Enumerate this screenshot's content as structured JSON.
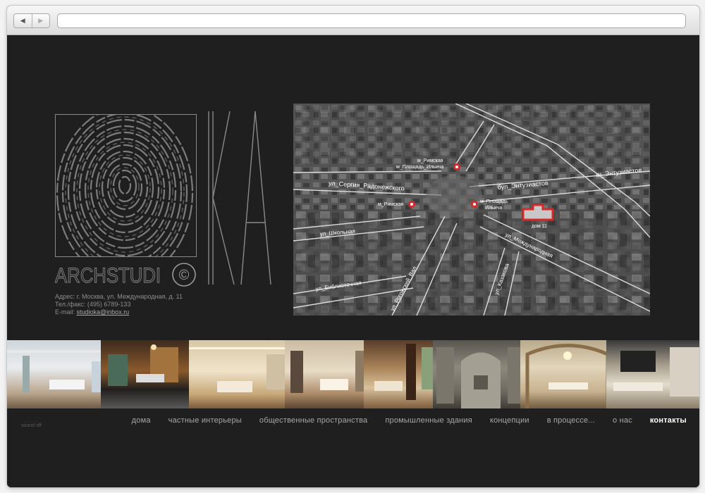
{
  "browser": {
    "back_glyph": "◀",
    "forward_glyph": "▶",
    "url": ""
  },
  "logo": {
    "word": "ARCHSTUDI",
    "copyright_glyph": "©",
    "initials": "KA",
    "icon": "fingerprint-icon"
  },
  "contact": {
    "address": "Адрес: г. Москва, ул. Международная, д. 11",
    "phone": "Тел./факс: (495) 6789-133",
    "email_label": "E-mail: ",
    "email": "studioka@inbox.ru"
  },
  "map": {
    "streets": {
      "radonezh": "ул_Сергия_Радонежского",
      "entuziastov_bul": "бул_Энтузиастов",
      "entuziastov_sh": "ш_Энтузиастов",
      "shkolnaya": "ул_Школьная",
      "mezhdunarodnaya": "ул_Международная",
      "bibliotechnaya": "ул_Библиотечная",
      "rogozhsky": "ул_Рогожский_Вал",
      "kazakova": "ул_Казакова"
    },
    "metro": {
      "top_line1": "м_Римская",
      "top_line2": "м_Площадь_Ильича",
      "left": "м_Римская",
      "right_line1": "м_Площадь",
      "right_line2": "Ильича"
    },
    "building": "дом 11",
    "marker_color": "#d42a2a"
  },
  "photos": [
    {
      "name": "white-living-room"
    },
    {
      "name": "dark-marble-interior"
    },
    {
      "name": "beige-lounge"
    },
    {
      "name": "long-gallery-room"
    },
    {
      "name": "screen-lounge"
    },
    {
      "name": "stone-fireplace-hall"
    },
    {
      "name": "classic-dining-room"
    },
    {
      "name": "modern-tv-room"
    }
  ],
  "sound": {
    "dots": "........",
    "label": "sound off"
  },
  "nav": [
    {
      "label": "дома"
    },
    {
      "label": "частные интерьеры"
    },
    {
      "label": "общественные пространства"
    },
    {
      "label": "промышленные здания"
    },
    {
      "label": "концепции"
    },
    {
      "label": "в процессе..."
    },
    {
      "label": "о нас"
    },
    {
      "label": "контакты",
      "active": true
    }
  ]
}
